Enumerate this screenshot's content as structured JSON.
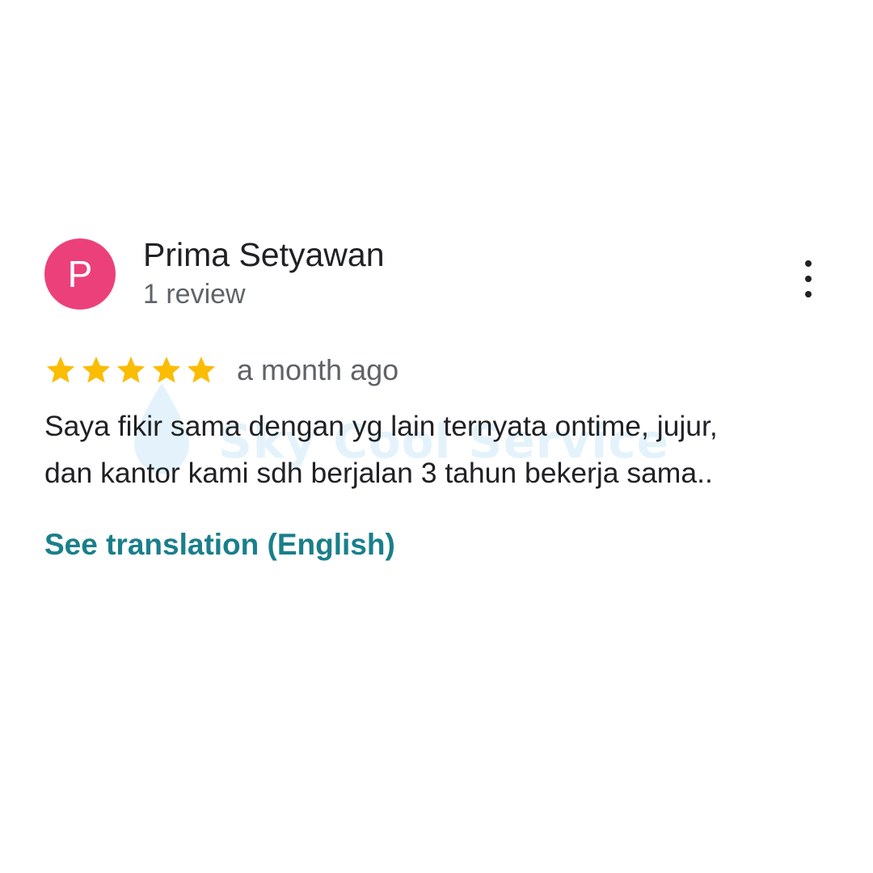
{
  "watermark": {
    "text": "Sky Cool Service",
    "color": "#3aa6e6"
  },
  "review": {
    "avatar": {
      "initial": "P",
      "color": "#ec407a"
    },
    "reviewer_name": "Prima Setyawan",
    "review_count": "1 review",
    "more_menu_icon": "more-vertical-icon",
    "rating": {
      "stars": 5,
      "max": 5,
      "star_color": "#fbbc04",
      "icon": "star-icon"
    },
    "timestamp": "a month ago",
    "text_lines": [
      "Saya fikir sama dengan yg lain ternyata ontime, jujur,",
      "dan kantor kami sdh berjalan 3 tahun bekerja sama.."
    ],
    "translate_link": "See translation (English)",
    "link_color": "#1a7f8a"
  }
}
